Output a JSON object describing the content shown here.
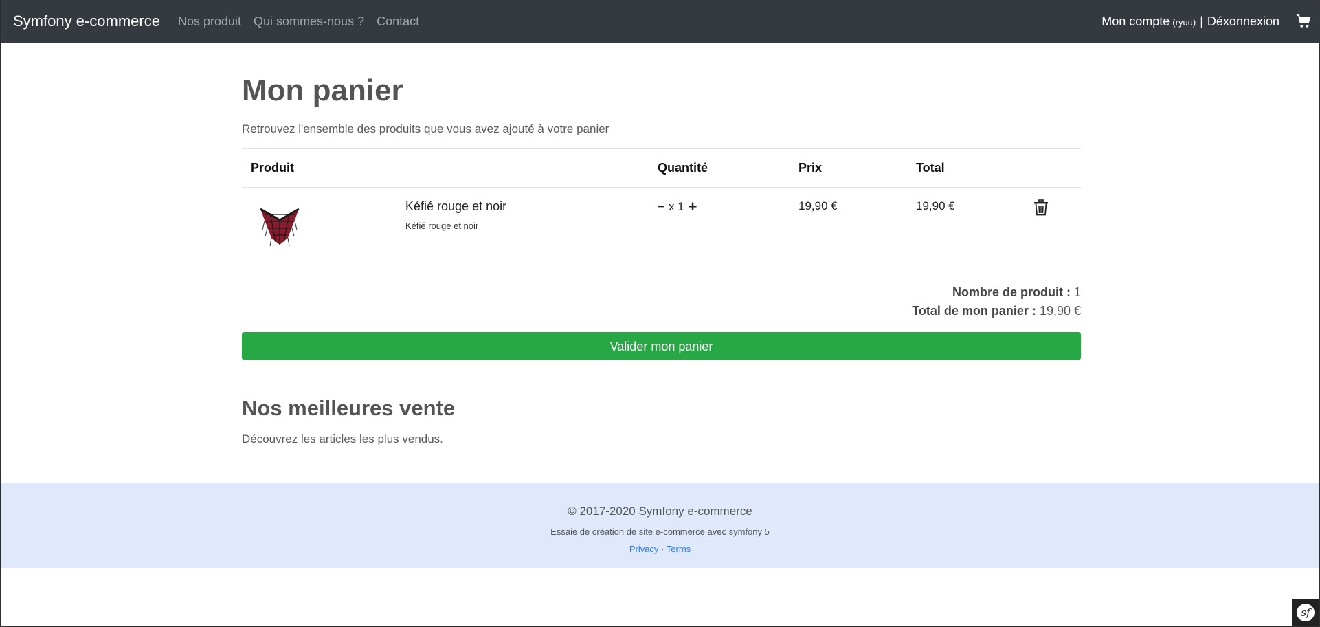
{
  "nav": {
    "brand": "Symfony e-commerce",
    "links": [
      "Nos produit",
      "Qui sommes-nous ?",
      "Contact"
    ],
    "account_label": "Mon compte",
    "account_user": "(ryuu)",
    "separator": "|",
    "logout": "Déxonnexion",
    "cart_icon": "shopping-cart-icon"
  },
  "page": {
    "title": "Mon panier",
    "subtitle": "Retrouvez l'ensemble des produits que vous avez ajouté à votre panier"
  },
  "table": {
    "headers": {
      "product": "Produit",
      "quantity": "Quantité",
      "price": "Prix",
      "total": "Total"
    },
    "rows": [
      {
        "name": "Kéfié rouge et noir",
        "description": "Kéfié rouge et noir",
        "minus": "−",
        "qty": "x 1",
        "plus": "+",
        "price": "19,90 €",
        "total": "19,90 €",
        "delete_icon": "trash-icon"
      }
    ]
  },
  "summary": {
    "count_label": "Nombre de produit :",
    "count_value": "1",
    "total_label": "Total de mon panier :",
    "total_value": "19,90 €"
  },
  "validate_button": "Valider mon panier",
  "best": {
    "title": "Nos meilleures vente",
    "subtitle": "Découvrez les articles les plus vendus."
  },
  "footer": {
    "copyright": "© 2017-2020 Symfony e-commerce",
    "description": "Essaie de création de site e-commerce avec symfony 5",
    "privacy": "Privacy",
    "dot": "·",
    "terms": "Terms"
  },
  "colors": {
    "navbar": "#343a40",
    "success": "#28a745",
    "footer_bg": "#dfe9fb",
    "link": "#2c7be5"
  },
  "debug_badge_icon": "symfony-toolbar-icon",
  "debug_badge_text": "sf"
}
